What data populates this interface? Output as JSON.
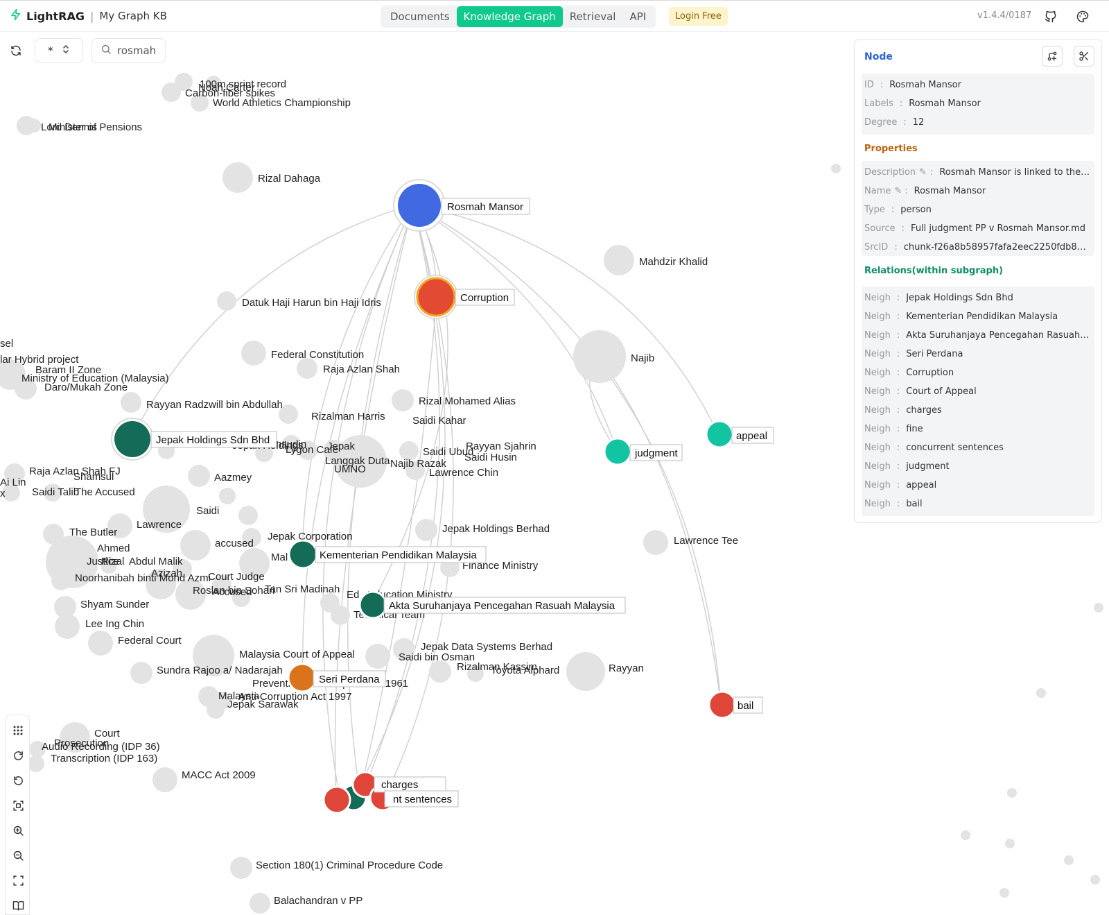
{
  "header": {
    "app_name": "LightRAG",
    "separator": "|",
    "kb_name": "My Graph KB",
    "tabs": [
      {
        "label": "Documents",
        "active": false
      },
      {
        "label": "Knowledge Graph",
        "active": true
      },
      {
        "label": "Retrieval",
        "active": false
      },
      {
        "label": "API",
        "active": false
      }
    ],
    "login_label": "Login Free",
    "version": "v1.4.4/0187",
    "accent_color": "#10c98c"
  },
  "controls": {
    "label_select_value": "*",
    "search_value": "rosmah",
    "icons": [
      "refresh-icon",
      "chevron-updown-icon",
      "search-icon"
    ]
  },
  "toolbar": {
    "tools": [
      "layout-grid-icon",
      "rotate-cw-icon",
      "rotate-ccw-icon",
      "zoom-to-selection-icon",
      "zoom-in-icon",
      "zoom-out-icon",
      "fullscreen-icon",
      "legend-book-icon"
    ]
  },
  "panel": {
    "title": "Node",
    "basic": [
      {
        "key": "ID",
        "value": "Rosmah Mansor"
      },
      {
        "key": "Labels",
        "value": "Rosmah Mansor"
      },
      {
        "key": "Degree",
        "value": "12"
      }
    ],
    "properties_title": "Properties",
    "properties": [
      {
        "key": "Description",
        "editable": true,
        "value": "Rosmah Mansor is linked to the al..."
      },
      {
        "key": "Name",
        "editable": true,
        "value": "Rosmah Mansor"
      },
      {
        "key": "Type",
        "editable": false,
        "value": "person"
      },
      {
        "key": "Source",
        "editable": false,
        "value": "Full judgment PP v Rosmah Mansor.md"
      },
      {
        "key": "SrcID",
        "editable": false,
        "value": "chunk-f26a8b58957fafa2eec2250fdb871..."
      }
    ],
    "relations_title": "Relations(within subgraph)",
    "relation_key": "Neigh",
    "relations": [
      "Jepak Holdings Sdn Bhd",
      "Kementerian Pendidikan Malaysia",
      "Akta Suruhanjaya Pencegahan Rasuah M...",
      "Seri Perdana",
      "Corruption",
      "Court of Appeal",
      "charges",
      "fine",
      "concurrent sentences",
      "judgment",
      "appeal",
      "bail"
    ]
  },
  "graph": {
    "colors": {
      "selected": "#4169e1",
      "corruption": "#e24b32",
      "org": "#136b58",
      "teal": "#13c4a3",
      "red": "#e0453a",
      "orange": "#d9741c",
      "gray": "#e3e3e3"
    },
    "highlighted_labels": [
      "Rosmah Mansor",
      "Corruption",
      "Jepak Holdings Sdn Bhd",
      "judgment",
      "appeal",
      "Kementerian Pendidikan Malaysia",
      "Akta Suruhanjaya Pencegahan Rasuah Malaysia",
      "Seri Perdana",
      "bail",
      "charges",
      "nt sentences"
    ],
    "labels": [
      "100m sprint record",
      "Noah Carter",
      "Carbon-fiber spikes",
      "World Athletics Championship",
      "Lord Dennis",
      "Minister of Pensions",
      "Rizal Dahaga",
      "Mahdzir Khalid",
      "Datuk Haji Harun bin Haji Idris",
      "sel",
      "lar Hybrid project",
      "Baram II Zone",
      "Ministry of Education (Malaysia)",
      "Daro/Mukah Zone",
      "Federal Constitution",
      "Raja Azlan Shah",
      "Najib",
      "Rayyan Radzwill bin Abdullah",
      "Rizalman Harris",
      "Rizal Mohamed Alias",
      "Saidi Kahar",
      "Jepak Holdings",
      "nsudin",
      "Lygon Cafe",
      "Jepak",
      "Langgak Duta",
      "UMNO",
      "Najib Razak",
      "Saidi Ubud",
      "Rayyan Sjahrin",
      "Saidi Husin",
      "Lawrence Chin",
      "Raja Azlan Shah FJ",
      "Shamsul",
      "Ai Lin",
      "Saidi Talib",
      "The Accused",
      "x",
      "Aazmey",
      "Saidi",
      "Lawrence",
      "The Butler",
      "accused",
      "Jepak Corporation",
      "Jepak Holdings Berhad",
      "Lawrence Tee",
      "Ahmed",
      "Justice",
      "Rizal",
      "Abdul Malik",
      "Mal",
      "Finance Ministry",
      "Azizah",
      "Noorhanibah binti Mohd Azmi",
      "Court Judge",
      "Roslan bin Sohari",
      "Accused",
      "Tan Sri Madinah",
      "Ed",
      "Education Ministry",
      "Technical Team",
      "Shyam Sunder",
      "Lee Ing Chin",
      "Federal Court",
      "Jepak Data Systems Berhad",
      "Saidi bin Osman",
      "Malaysia Court of Appeal",
      "Rizalman Kassim",
      "Toyota Alphard",
      "Rayyan",
      "Sundra Rajoo a/ Nadarajah",
      "Prevention of Corruption Act 1961",
      "Malaysia",
      "Anti-Corruption Act 1997",
      "Jepak Sarawak",
      "Court",
      "Prosecution",
      "Audio Recording (IDP 36)",
      "Transcription (IDP 163)",
      "MACC Act 2009",
      "Section 180(1) Criminal Procedure Code",
      "Balachandran v PP"
    ]
  }
}
